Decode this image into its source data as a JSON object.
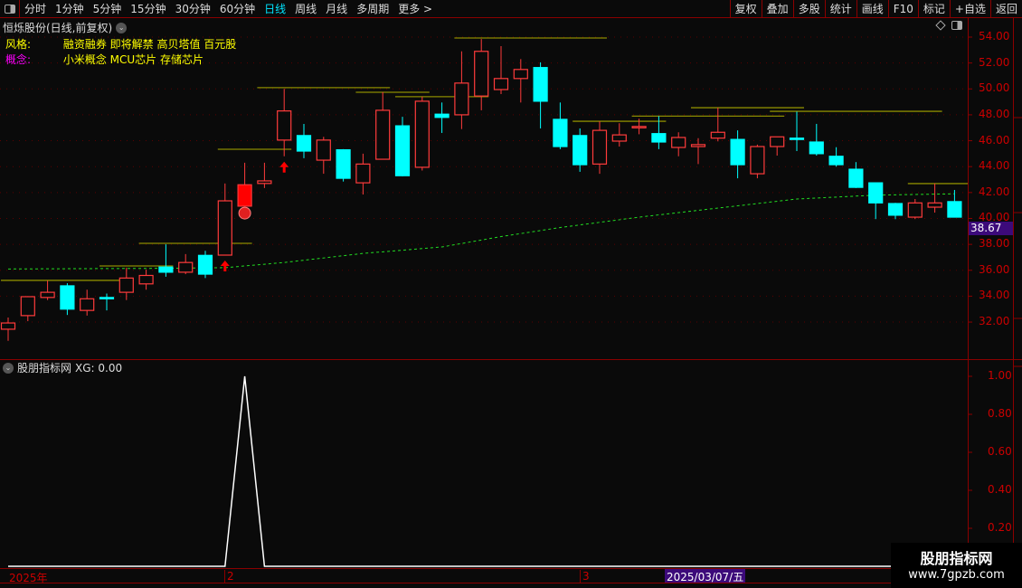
{
  "toolbar": {
    "periods": [
      "分时",
      "1分钟",
      "5分钟",
      "15分钟",
      "30分钟",
      "60分钟",
      "日线",
      "周线",
      "月线",
      "多周期",
      "更多 >"
    ],
    "active_period": "日线",
    "right_buttons": [
      "复权",
      "叠加",
      "多股",
      "统计",
      "画线",
      "F10",
      "标记",
      "+自选",
      "返回"
    ]
  },
  "chart": {
    "title": "恒烁股份(日线,前复权)",
    "style_label": "风格:",
    "style_value": "融资融券 即将解禁 高贝塔值 百元股",
    "concept_label": "概念:",
    "concept_value": "小米概念 MCU芯片 存储芯片",
    "price_labels": [
      "54.00",
      "52.00",
      "50.00",
      "48.00",
      "46.00",
      "44.00",
      "42.00",
      "40.00",
      "38.00",
      "36.00",
      "34.00",
      "32.00"
    ],
    "current_price": "38.67",
    "colors": {
      "up": "#ff3b3b",
      "down": "#00ffff",
      "ma": "#22dd22",
      "resistance": "#8a8a00",
      "indicator": "#ffffff",
      "style": "#ffff00",
      "concept_label": "#ff00ff"
    },
    "candles": [
      [
        31.45,
        32.35,
        30.55,
        31.93
      ],
      [
        32.5,
        34.0,
        32.07,
        33.96
      ],
      [
        33.9,
        35.2,
        33.7,
        34.3
      ],
      [
        34.8,
        35.0,
        32.55,
        33.0
      ],
      [
        32.9,
        34.5,
        32.5,
        33.8
      ],
      [
        33.9,
        34.2,
        32.9,
        33.88
      ],
      [
        34.3,
        36.2,
        33.7,
        35.4
      ],
      [
        34.95,
        36.05,
        34.5,
        35.6
      ],
      [
        36.25,
        38.0,
        35.5,
        35.85
      ],
      [
        35.85,
        37.25,
        35.7,
        36.6
      ],
      [
        37.15,
        37.5,
        35.4,
        35.7
      ],
      [
        37.17,
        42.7,
        37.17,
        41.36
      ],
      [
        40.95,
        44.3,
        40.9,
        42.6
      ],
      [
        42.7,
        44.3,
        42.35,
        42.9
      ],
      [
        46.05,
        50.0,
        44.8,
        48.3
      ],
      [
        46.4,
        47.3,
        44.65,
        45.2
      ],
      [
        44.5,
        46.3,
        43.45,
        46.05
      ],
      [
        45.3,
        45.35,
        42.85,
        43.1
      ],
      [
        42.75,
        45.0,
        41.85,
        44.2
      ],
      [
        44.57,
        49.75,
        44.57,
        48.35
      ],
      [
        47.15,
        47.85,
        43.25,
        43.3
      ],
      [
        43.95,
        49.4,
        43.7,
        49.05
      ],
      [
        48.05,
        48.95,
        46.6,
        47.8
      ],
      [
        48.0,
        52.9,
        46.9,
        50.45
      ],
      [
        49.45,
        53.85,
        48.35,
        52.9
      ],
      [
        49.95,
        53.3,
        49.6,
        50.8
      ],
      [
        50.8,
        52.3,
        48.95,
        51.5
      ],
      [
        51.65,
        52.05,
        46.95,
        49.05
      ],
      [
        47.65,
        48.95,
        45.35,
        45.55
      ],
      [
        46.4,
        46.95,
        43.6,
        44.15
      ],
      [
        44.2,
        47.5,
        43.45,
        46.8
      ],
      [
        45.97,
        47.35,
        45.55,
        46.45
      ],
      [
        47.05,
        47.7,
        46.5,
        47.1
      ],
      [
        46.55,
        47.9,
        45.35,
        45.9
      ],
      [
        45.48,
        46.65,
        44.8,
        46.25
      ],
      [
        45.55,
        46.2,
        44.2,
        45.7
      ],
      [
        46.2,
        48.55,
        45.95,
        46.65
      ],
      [
        46.1,
        46.8,
        43.1,
        44.15
      ],
      [
        43.45,
        45.7,
        43.1,
        45.55
      ],
      [
        45.55,
        46.3,
        44.85,
        46.3
      ],
      [
        46.2,
        48.25,
        45.2,
        46.15
      ],
      [
        45.9,
        47.3,
        44.85,
        45.0
      ],
      [
        44.8,
        45.5,
        44.0,
        44.15
      ],
      [
        43.8,
        44.35,
        42.35,
        42.4
      ],
      [
        42.75,
        42.75,
        39.95,
        41.2
      ],
      [
        41.15,
        41.2,
        39.95,
        40.25
      ],
      [
        40.1,
        41.5,
        39.95,
        41.2
      ],
      [
        40.87,
        42.7,
        40.45,
        41.2
      ],
      [
        41.3,
        42.2,
        40.1,
        40.1
      ]
    ],
    "solid_red_candles": [
      12
    ],
    "up_arrow_candles": [
      11,
      14
    ],
    "badge_candle": 12,
    "ma": [
      [
        0,
        36.1
      ],
      [
        8,
        36.15
      ],
      [
        11,
        36.2
      ],
      [
        14,
        36.6
      ],
      [
        18,
        37.3
      ],
      [
        22,
        37.8
      ],
      [
        25,
        38.6
      ],
      [
        28,
        39.3
      ],
      [
        32,
        40.1
      ],
      [
        36,
        40.8
      ],
      [
        40,
        41.5
      ],
      [
        44,
        41.8
      ],
      [
        48,
        41.9
      ]
    ],
    "resistance_lines": [
      [
        35.22,
        0,
        6
      ],
      [
        36.33,
        5,
        8
      ],
      [
        38.08,
        7,
        12
      ],
      [
        45.34,
        11,
        14
      ],
      [
        50.1,
        13,
        19
      ],
      [
        49.74,
        18,
        21
      ],
      [
        49.4,
        20,
        24
      ],
      [
        53.93,
        23,
        30
      ],
      [
        47.5,
        29,
        33
      ],
      [
        47.9,
        32,
        39
      ],
      [
        48.55,
        35,
        40
      ],
      [
        48.27,
        39,
        47
      ],
      [
        42.69,
        46,
        49
      ]
    ]
  },
  "indicator": {
    "name": "股朋指标网",
    "readout": "XG: 0.00",
    "axis_labels": [
      "1.00",
      "0.80",
      "0.60",
      "0.40",
      "0.20"
    ],
    "values": [
      0,
      0,
      0,
      0,
      0,
      0,
      0,
      0,
      0,
      0,
      0,
      0,
      1,
      0,
      0,
      0,
      0,
      0,
      0,
      0,
      0,
      0,
      0,
      0,
      0,
      0,
      0,
      0,
      0,
      0,
      0,
      0,
      0,
      0,
      0,
      0,
      0,
      0,
      0,
      0,
      0,
      0,
      0,
      0,
      0,
      0,
      0,
      0,
      0
    ]
  },
  "date_axis": {
    "year_label": "2025年",
    "month_feb": "2",
    "month_mar": "3",
    "current_date": "2025/03/07/五"
  },
  "watermark": {
    "name": "股朋指标网",
    "url": "www.7gpzb.com"
  }
}
